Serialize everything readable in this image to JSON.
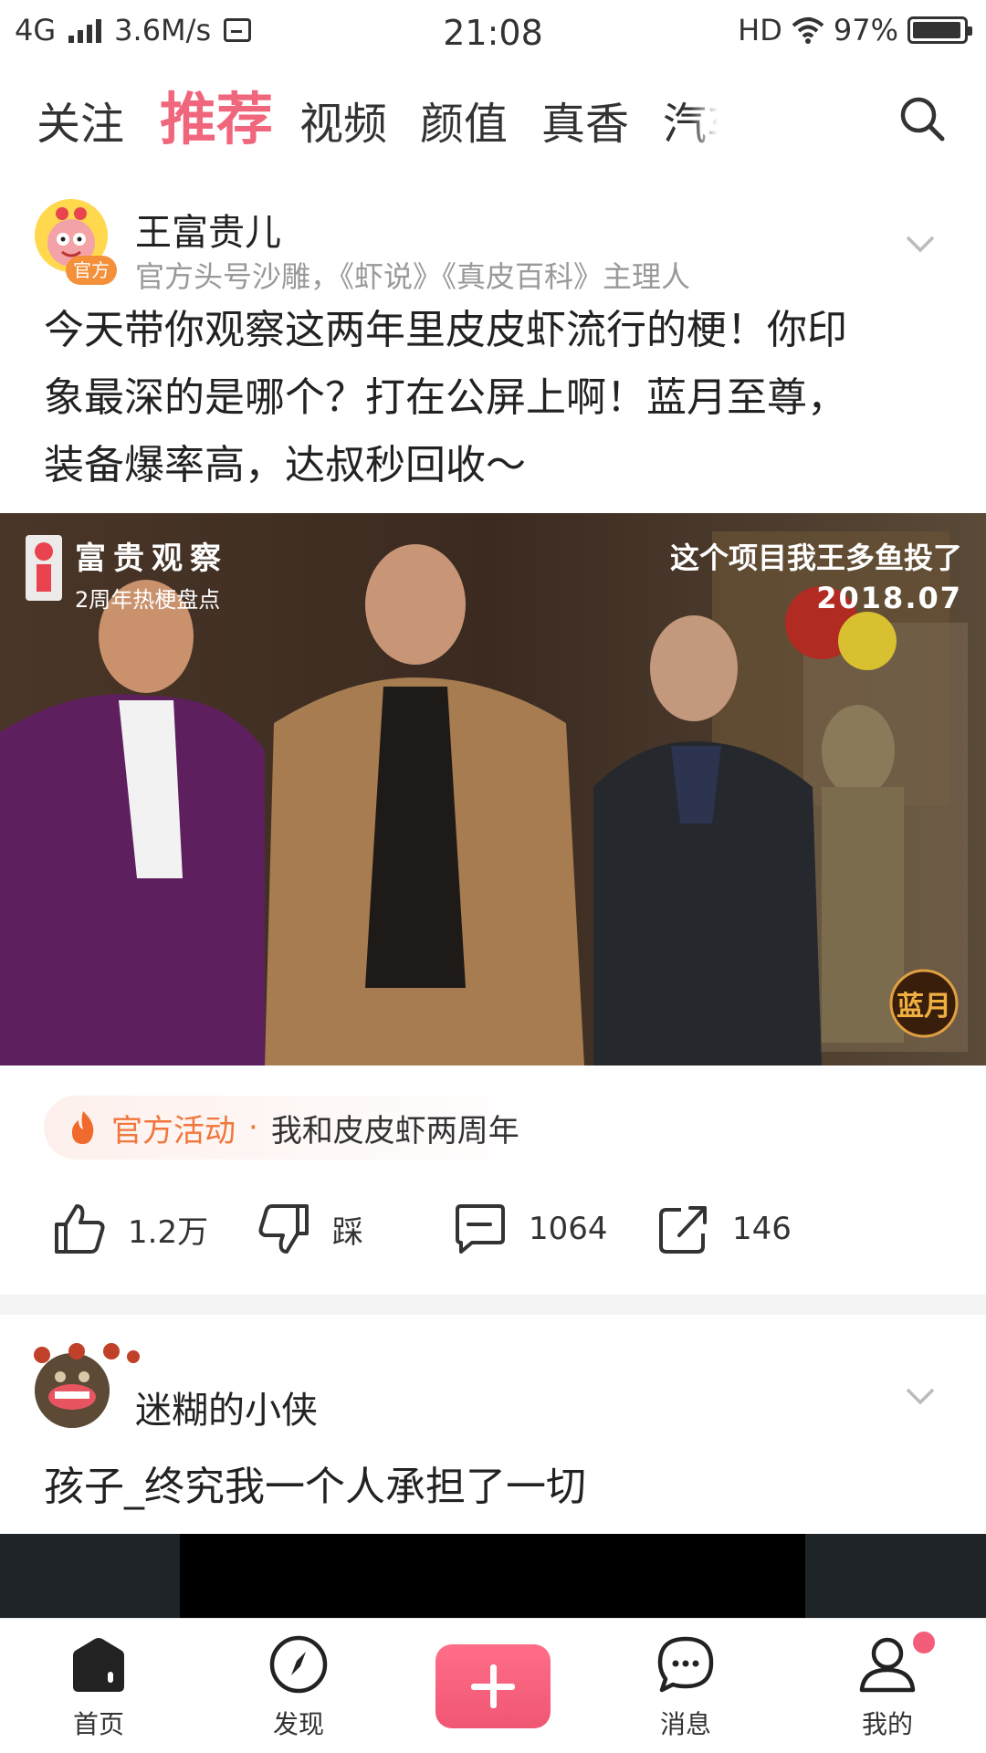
{
  "status_bar": {
    "network": "4G",
    "speed": "3.6M/s",
    "time": "21:08",
    "hd": "HD",
    "battery": "97%",
    "battery_level": 0.97
  },
  "top_tabs": [
    {
      "label": "关注",
      "active": false
    },
    {
      "label": "推荐",
      "active": true
    },
    {
      "label": "视频",
      "active": false
    },
    {
      "label": "颜值",
      "active": false
    },
    {
      "label": "真香",
      "active": false
    },
    {
      "label": "汽车",
      "active": false
    }
  ],
  "post1": {
    "author": "王富贵儿",
    "official_badge": "官方",
    "subtitle": "官方头号沙雕，《虾说》《真皮百科》主理人",
    "text_lines": [
      "今天带你观察这两年里皮皮虾流行的梗！你印",
      "象最深的是哪个？打在公屏上啊！蓝月至尊，",
      "装备爆率高，达叔秒回收～"
    ],
    "video": {
      "caption_title": "富贵观察",
      "caption_sub": "2周年热梗盘点",
      "overlay_line1": "这个项目我王多鱼投了",
      "overlay_line2": "2018.07",
      "logo_text": "蓝月"
    },
    "activity": {
      "label": "官方活动",
      "separator": "·",
      "text": "我和皮皮虾两周年"
    },
    "actions": {
      "like_count": "1.2万",
      "dislike_label": "踩",
      "comment_count": "1064",
      "share_count": "146"
    }
  },
  "post2": {
    "author": "迷糊的小侠",
    "text": "孩子_终究我一个人承担了一切"
  },
  "bottom_nav": [
    {
      "label": "首页"
    },
    {
      "label": "发现"
    },
    {
      "label": "消息"
    },
    {
      "label": "我的"
    }
  ],
  "colors": {
    "accent": "#f0677d",
    "activity_orange": "#f0763d",
    "muted_text": "#999999"
  }
}
